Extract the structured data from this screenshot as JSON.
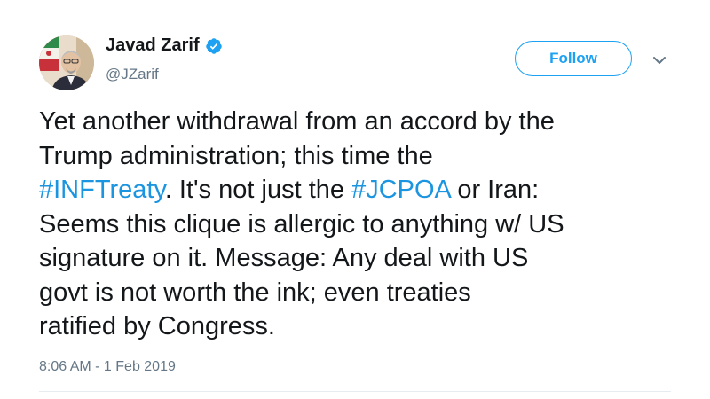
{
  "author": {
    "display_name": "Javad Zarif",
    "handle": "@JZarif",
    "verified": true,
    "avatar_icon": "profile-photo"
  },
  "actions": {
    "follow_label": "Follow",
    "menu_icon": "chevron-down-icon"
  },
  "tweet": {
    "lines": [
      [
        {
          "text": "Yet another withdrawal from an accord by the"
        }
      ],
      [
        {
          "text": "Trump administration; this time the"
        }
      ],
      [
        {
          "text": "#INFTreaty",
          "hashtag": true
        },
        {
          "text": ". It's not just the "
        },
        {
          "text": "#JCPOA",
          "hashtag": true
        },
        {
          "text": " or Iran:"
        }
      ],
      [
        {
          "text": "Seems this clique is allergic to anything w/ US"
        }
      ],
      [
        {
          "text": "signature on it. Message: Any deal with US"
        }
      ],
      [
        {
          "text": "govt is not worth the ink; even treaties"
        }
      ],
      [
        {
          "text": "ratified by Congress."
        }
      ]
    ],
    "timestamp": "8:06 AM - 1 Feb 2019"
  },
  "colors": {
    "accent": "#1da1f2",
    "hashtag": "#1b95e0",
    "secondary_text": "#657786",
    "primary_text": "#14171a"
  }
}
